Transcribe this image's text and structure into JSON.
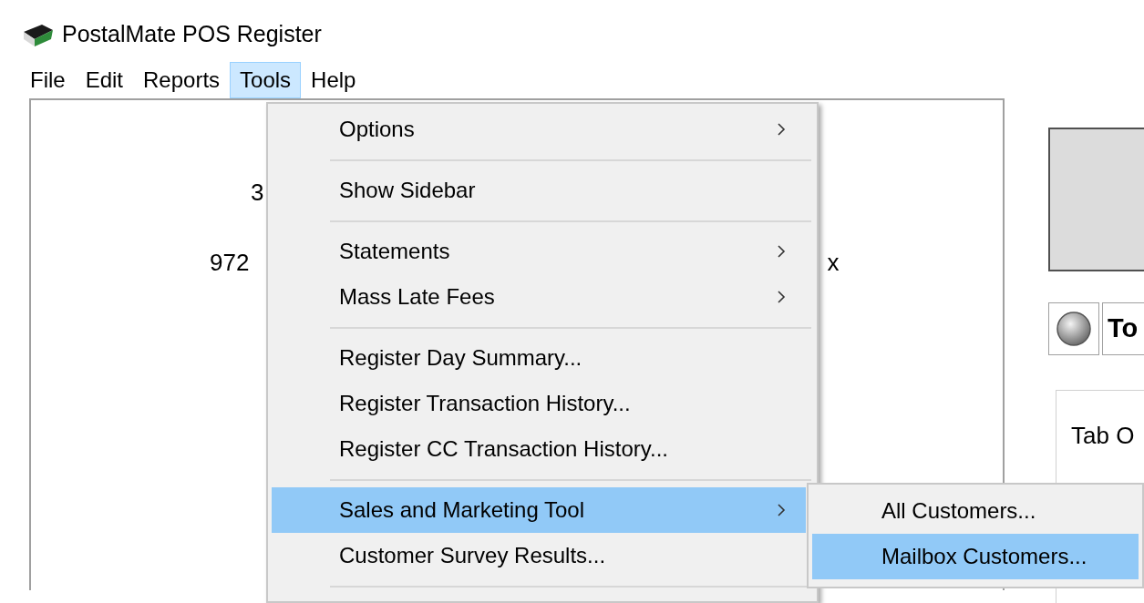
{
  "window": {
    "title": "PostalMate POS Register"
  },
  "menu_bar": [
    {
      "label": "File",
      "selected": false
    },
    {
      "label": "Edit",
      "selected": false
    },
    {
      "label": "Reports",
      "selected": false
    },
    {
      "label": "Tools",
      "selected": true
    },
    {
      "label": "Help",
      "selected": false
    }
  ],
  "main_panel": {
    "line_1": "3",
    "line_2_start": "972",
    "line_2_end": "x"
  },
  "right_panel": {
    "label": "To",
    "tab_text": "Tab O"
  },
  "tools_menu": [
    {
      "kind": "item",
      "label": "Options",
      "has_submenu": true,
      "selected": false
    },
    {
      "kind": "separator"
    },
    {
      "kind": "item",
      "label": "Show Sidebar",
      "has_submenu": false,
      "selected": false
    },
    {
      "kind": "separator"
    },
    {
      "kind": "item",
      "label": "Statements",
      "has_submenu": true,
      "selected": false
    },
    {
      "kind": "item",
      "label": "Mass Late Fees",
      "has_submenu": true,
      "selected": false
    },
    {
      "kind": "separator"
    },
    {
      "kind": "item",
      "label": "Register Day Summary...",
      "has_submenu": false,
      "selected": false
    },
    {
      "kind": "item",
      "label": "Register Transaction History...",
      "has_submenu": false,
      "selected": false
    },
    {
      "kind": "item",
      "label": "Register CC Transaction History...",
      "has_submenu": false,
      "selected": false
    },
    {
      "kind": "separator"
    },
    {
      "kind": "item",
      "label": "Sales and Marketing Tool",
      "has_submenu": true,
      "selected": true
    },
    {
      "kind": "item",
      "label": "Customer Survey Results...",
      "has_submenu": false,
      "selected": false
    },
    {
      "kind": "separator"
    }
  ],
  "submenu": [
    {
      "label": "All Customers...",
      "selected": false
    },
    {
      "label": "Mailbox Customers...",
      "selected": true
    }
  ]
}
